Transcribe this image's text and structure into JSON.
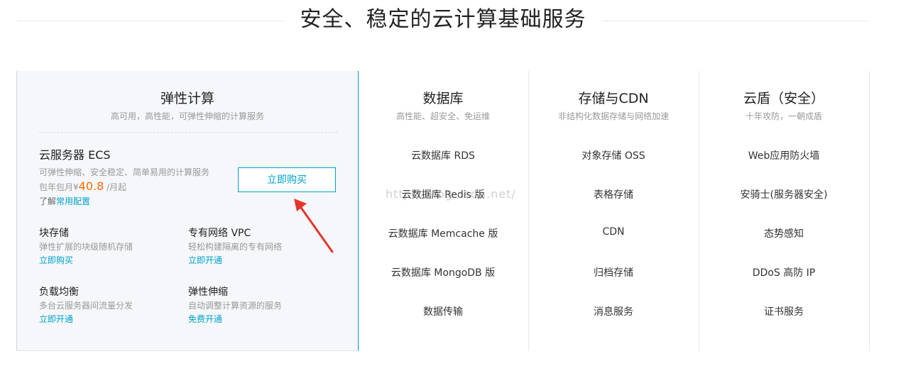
{
  "hero": {
    "title": "安全、稳定的云计算基础服务"
  },
  "elastic": {
    "title": "弹性计算",
    "subtitle": "高可用，高性能，可弹性伸缩的计算服务",
    "ecs": {
      "title": "云服务器 ECS",
      "desc": "可弹性伸缩、安全稳定、简单易用的计算服务",
      "price_prefix": "包年包月",
      "currency": "¥",
      "price": "40.8",
      "price_suffix": " /月起",
      "more_prefix": "了解",
      "more_link": "常用配置",
      "buy_label": "立即购买"
    },
    "items": [
      {
        "title": "块存储",
        "desc": "弹性扩展的块级随机存储",
        "link": "立即购买"
      },
      {
        "title": "专有网络 VPC",
        "desc": "轻松构建隔离的专有网络",
        "link": "立即开通"
      },
      {
        "title": "负载均衡",
        "desc": "多台云服务器间流量分发",
        "link": "立即开通"
      },
      {
        "title": "弹性伸缩",
        "desc": "自动调整计算资源的服务",
        "link": "免费开通"
      }
    ]
  },
  "columns": [
    {
      "title": "数据库",
      "subtitle": "高性能、超安全、免运维",
      "items": [
        "云数据库 RDS",
        "云数据库 Redis 版",
        "云数据库 Memcache 版",
        "云数据库 MongoDB 版",
        "数据传输"
      ]
    },
    {
      "title": "存储与CDN",
      "subtitle": "非结构化数据存储与网络加速",
      "items": [
        "对象存储 OSS",
        "表格存储",
        "CDN",
        "归档存储",
        "消息服务"
      ]
    },
    {
      "title": "云盾（安全）",
      "subtitle": "十年攻防，一朝成盾",
      "items": [
        "Web应用防火墙",
        "安骑士(服务器安全)",
        "态势感知",
        "DDoS 高防 IP",
        "证书服务"
      ]
    }
  ],
  "watermark": "http://blog.csdn.net/",
  "colors": {
    "accent": "#00a2ca",
    "price": "#ff6a00",
    "arrow": "#e8342e"
  }
}
